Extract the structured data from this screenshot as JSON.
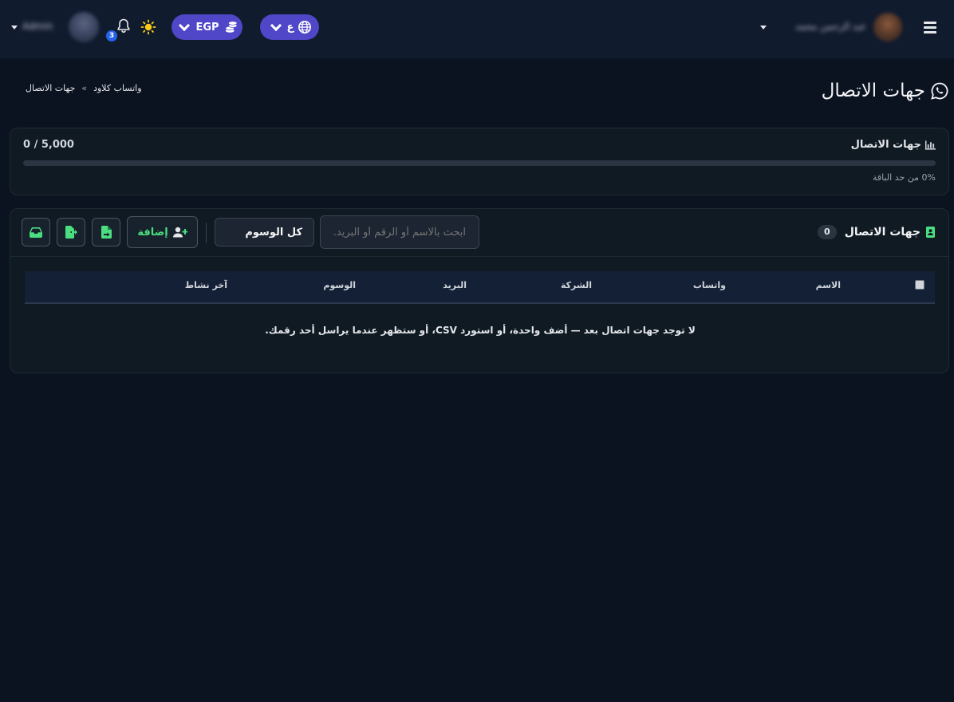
{
  "topbar": {
    "user_right_name": "عبد الرحمن محمد",
    "user_left_name": "Admin",
    "language": "ع",
    "currency": "EGP",
    "notifications_count": "3"
  },
  "header": {
    "title": "جهات الاتصال",
    "breadcrumb": [
      "واتساب كلاود",
      "جهات الاتصال"
    ],
    "breadcrumb_sep": "»"
  },
  "usage": {
    "title": "جهات الاتصال",
    "count": "0 / 5,000",
    "percent_label": "0% من حد الباقة",
    "progress": 0
  },
  "contacts": {
    "title": "جهات الاتصال",
    "count": "0",
    "search_placeholder": "ابحث بالاسم أو الرقم أو البريد..",
    "tag_filter": "كل الوسوم",
    "add_label": "إضافة",
    "columns": [
      "الاسم",
      "واتساب",
      "الشركة",
      "البريد",
      "الوسوم",
      "آخر نشاط"
    ],
    "empty_message": "لا توجد جهات اتصال بعد — أضف واحدة، أو استورد CSV، أو ستظهر عندما يراسل أحد رقمك."
  },
  "colors": {
    "accent": "#4f46c8",
    "success": "#4ade80",
    "background": "#0b1220"
  },
  "icons": [
    "menu-icon",
    "bell-icon",
    "sun-icon",
    "coins-icon",
    "globe-icon",
    "whatsapp-icon",
    "chart-icon",
    "contact-book-icon",
    "user-plus-icon",
    "file-import-icon",
    "file-export-icon",
    "inbox-icon"
  ]
}
